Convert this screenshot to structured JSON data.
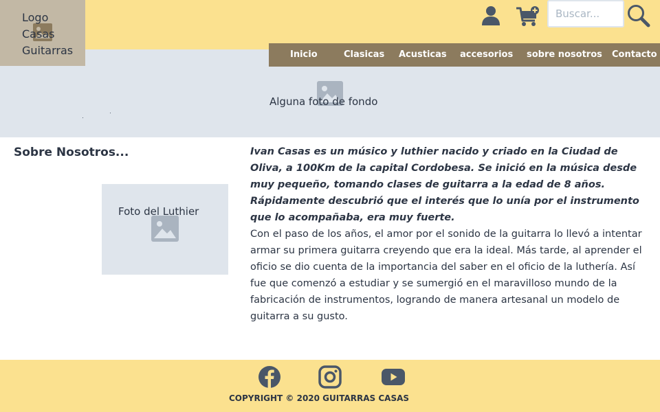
{
  "logo": {
    "text": "Logo Casas Guitarras"
  },
  "header": {
    "user_icon": "user-icon",
    "cart_icon": "cart-add-icon",
    "search": {
      "placeholder": "Buscar...",
      "value": ""
    },
    "search_icon": "magnifier-icon"
  },
  "nav": {
    "items": [
      {
        "label": "Inicio"
      },
      {
        "label": "Clasicas"
      },
      {
        "label": "Acusticas"
      },
      {
        "label": "accesorios"
      },
      {
        "label": "sobre nosotros"
      },
      {
        "label": "Contacto"
      }
    ]
  },
  "hero": {
    "caption": "Alguna foto de fondo",
    "image_icon": "image-placeholder-icon"
  },
  "about": {
    "title": "Sobre Nosotros...",
    "photo_caption": "Foto del Luthier",
    "lead": "Ivan Casas es un músico y luthier nacido y criado en la Ciudad de Oliva, a 100Km de la capital Cordobesa. Se inició en la música desde muy pequeño, tomando clases de guitarra a la edad de 8 años. Rápidamente descubrió que el interés que lo unía por el instrumento que lo acompañaba, era muy fuerte.",
    "body": "Con el paso de los años, el amor por el sonido de la guitarra lo llevó a intentar armar su primera guitarra creyendo que era la ideal. Más tarde, al aprender el oficio se dio cuenta de la importancia del saber en el oficio de la luthería. Así fue que comenzó a estudiar y se sumergió en el maravilloso mundo de la fabricación de instrumentos, logrando de manera artesanal un modelo de guitarra a su gusto."
  },
  "footer": {
    "social": [
      "facebook-icon",
      "instagram-icon",
      "youtube-icon"
    ],
    "copyright": "COPYRIGHT © 2020 GUITARRAS CASAS"
  },
  "colors": {
    "header_bg": "#fbe18f",
    "logo_bg": "#c2b8a5",
    "nav_bg": "#8c7b5e",
    "placeholder_bg": "#dfe5ec",
    "icon": "#4a5768",
    "text": "#2c3544"
  }
}
